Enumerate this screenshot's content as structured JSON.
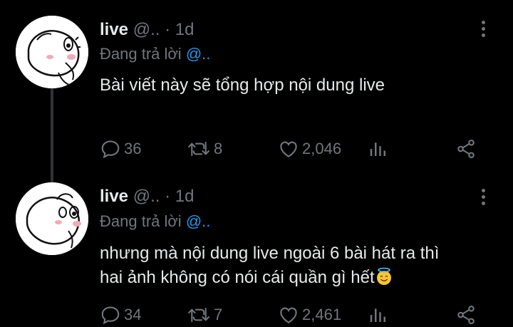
{
  "tweets": [
    {
      "name": "live",
      "handle": "@..",
      "separator": "·",
      "time": "1d",
      "reply_prefix": "Đang trả lời",
      "reply_handle": "@..",
      "text_lines": [
        "Bài viết này sẽ tổng hợp nội dung live"
      ],
      "replies": "36",
      "retweets": "8",
      "likes": "2,046"
    },
    {
      "name": "live",
      "handle": "@..",
      "separator": "·",
      "time": "1d",
      "reply_prefix": "Đang trả lời",
      "reply_handle": "@..",
      "text_lines": [
        "nhưng mà nội dung live ngoài 6 bài hát ra thì",
        "hai ảnh không có nói cái quần gì hết"
      ],
      "replies": "34",
      "retweets": "7",
      "likes": "2,461"
    }
  ],
  "icons": [
    "reply-icon",
    "retweet-icon",
    "like-icon",
    "views-icon",
    "share-icon",
    "more-icon",
    "halo-smile-emoji"
  ],
  "colors": {
    "background": "#000000",
    "text": "#e7e9ea",
    "muted": "#71767b",
    "link": "#1d9bf0",
    "thread_line": "#2f3336"
  }
}
